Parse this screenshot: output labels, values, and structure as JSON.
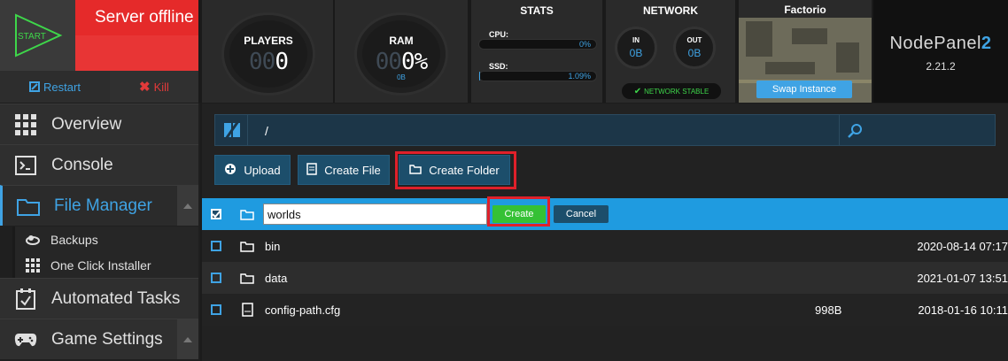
{
  "colors": {
    "accent": "#3fa3e4",
    "danger": "#e52a2a",
    "success": "#35c135",
    "highlight": "#e0202a"
  },
  "control": {
    "start_label": "START",
    "status": "Server offline",
    "restart_label": "Restart",
    "kill_label": "Kill"
  },
  "players": {
    "label": "PLAYERS",
    "dim_digits": "00",
    "value": "0"
  },
  "ram": {
    "label": "RAM",
    "dim_digits": "00",
    "value": "0%",
    "sub": "0B"
  },
  "stats": {
    "title": "STATS",
    "cpu_label": "CPU:",
    "cpu_value": "0%",
    "cpu_fraction": 0.0,
    "ssd_label": "SSD:",
    "ssd_value": "1.09%",
    "ssd_fraction": 0.0109
  },
  "network": {
    "title": "NETWORK",
    "in_label": "IN",
    "in_value": "0B",
    "out_label": "OUT",
    "out_value": "0B",
    "status": "NETWORK STABLE"
  },
  "game": {
    "title": "Factorio",
    "swap_label": "Swap Instance"
  },
  "brand": {
    "name": "NodePanel",
    "suffix": "2",
    "version": "2.21.2"
  },
  "sidebar": {
    "items": [
      {
        "label": "Overview",
        "icon": "grid-icon"
      },
      {
        "label": "Console",
        "icon": "terminal-icon"
      },
      {
        "label": "File Manager",
        "icon": "folder-icon"
      },
      {
        "label": "Automated Tasks",
        "icon": "tasks-icon"
      },
      {
        "label": "Game Settings",
        "icon": "gamepad-icon"
      }
    ],
    "subitems": [
      {
        "label": "Backups",
        "icon": "cloud-icon"
      },
      {
        "label": "One Click Installer",
        "icon": "grid-icon"
      }
    ]
  },
  "filemanager": {
    "path": "/",
    "upload_label": "Upload",
    "create_file_label": "Create File",
    "create_folder_label": "Create Folder",
    "new_folder_value": "worlds",
    "create_label": "Create",
    "cancel_label": "Cancel",
    "rows": [
      {
        "name": "bin",
        "type": "folder",
        "size": "",
        "date": "2020-08-14 07:17"
      },
      {
        "name": "data",
        "type": "folder",
        "size": "",
        "date": "2021-01-07 13:51"
      },
      {
        "name": "config-path.cfg",
        "type": "file",
        "size": "998B",
        "date": "2018-01-16 10:11"
      }
    ]
  }
}
